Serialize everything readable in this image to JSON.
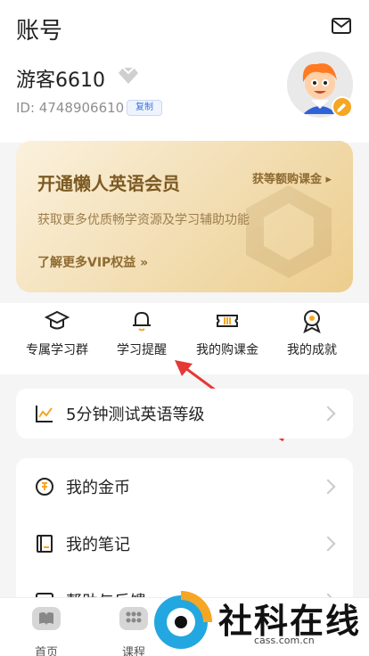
{
  "header": {
    "title": "账号",
    "username": "游客6610",
    "user_id": "ID: 4748906610",
    "copy_label": "复制"
  },
  "vip": {
    "title": "开通懒人英语会员",
    "subtitle": "获取更多优质畅学资源及学习辅助功能",
    "more": "了解更多VIP权益 »",
    "reward": "获等额购课金 ▸"
  },
  "features": [
    {
      "label": "专属学习群",
      "icon": "graduation-cap-icon"
    },
    {
      "label": "学习提醒",
      "icon": "bell-icon"
    },
    {
      "label": "我的购课金",
      "icon": "ticket-icon"
    },
    {
      "label": "我的成就",
      "icon": "medal-icon"
    }
  ],
  "test": {
    "label": "5分钟测试英语等级",
    "icon": "chart-line-icon"
  },
  "menu": [
    {
      "label": "我的金币",
      "icon": "coin-icon"
    },
    {
      "label": "我的笔记",
      "icon": "notebook-icon"
    },
    {
      "label": "帮助与反馈",
      "icon": "help-icon"
    }
  ],
  "tabs": [
    {
      "label": "首页",
      "icon": "book-icon"
    },
    {
      "label": "课程",
      "icon": "grid-icon"
    }
  ],
  "watermark": {
    "text": "社科在线",
    "url": "cass.com.cn"
  },
  "colors": {
    "accent": "#f5a623",
    "vip_text": "#7c5a23",
    "link_blue": "#3d73d6",
    "arrow_red": "#e53935"
  }
}
